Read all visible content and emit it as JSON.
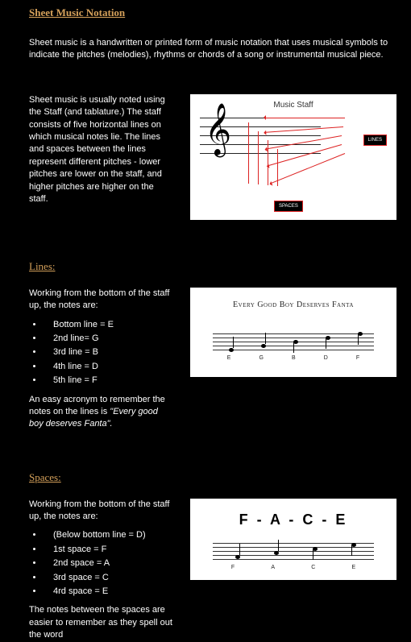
{
  "title": "Sheet Music Notation",
  "intro": "Sheet music is a handwritten or printed form of music notation that uses musical symbols to indicate the pitches (melodies), rhythms or chords of a song or instrumental musical piece.",
  "staff": {
    "text": "Sheet music is usually noted using the Staff (and tablature.) The staff consists of five horizontal lines on which musical notes lie. The lines and spaces between the lines represent different pitches - lower pitches are lower on the staff, and higher pitches are higher on the staff.",
    "fig_label": "Music Staff",
    "tag_lines": "LINES",
    "tag_spaces": "SPACES"
  },
  "lines": {
    "heading": "Lines:",
    "intro": "Working from the bottom of the staff up, the notes are:",
    "items": [
      "Bottom line = E",
      "2nd line= G",
      "3rd line = B",
      "4th line = D",
      "5th line = F"
    ],
    "note_prefix": "An easy acronym to remember the notes on the lines is ",
    "note_em": "\"Every good boy deserves Fanta\".",
    "fig_title": "Every  Good  Boy  Deserves  Fanta",
    "legend": [
      "E",
      "G",
      "B",
      "D",
      "F"
    ]
  },
  "spaces": {
    "heading": "Spaces:",
    "intro": "Working from the bottom of the staff up, the notes are:",
    "items": [
      "(Below bottom line = D)",
      "1st space = F",
      "2nd space = A",
      "3rd space = C",
      "4rd space = E"
    ],
    "note": "The notes between the spaces are easier to remember as they spell out the word",
    "fig_title": "F - A - C - E",
    "legend": [
      "F",
      "A",
      "C",
      "E"
    ]
  }
}
